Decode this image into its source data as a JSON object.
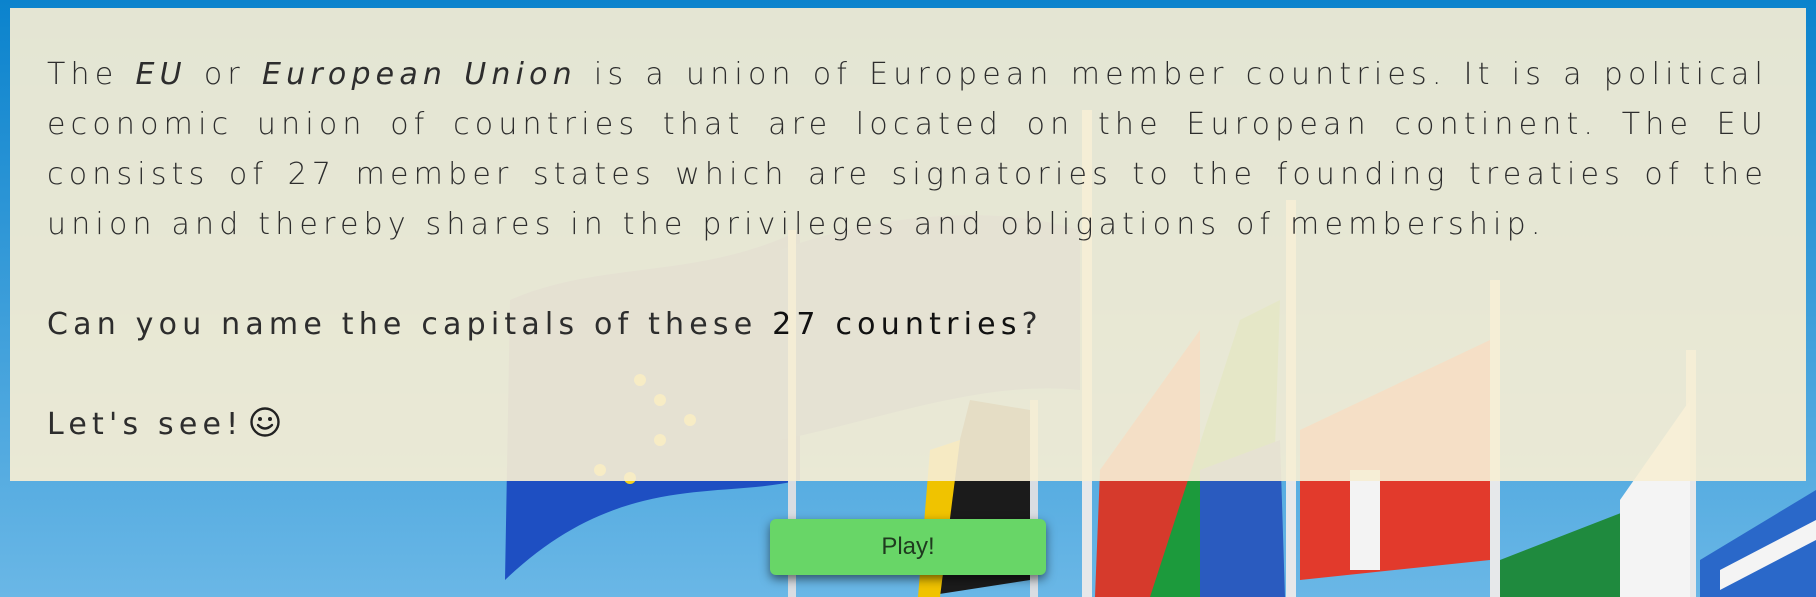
{
  "intro": {
    "p1_a": "The ",
    "p1_eu": "EU",
    "p1_b": " or ",
    "p1_european_union": "European Union",
    "p1_c": " is a union of European member countries. It is a political economic union of countries that are located on the European continent. The EU consists of 27 member states which are signatories to the founding treaties of the union and thereby shares in the privileges and obligations of membership.",
    "question_a": "Can you name the capitals of these ",
    "question_bold": "27 countries",
    "question_b": "?",
    "lets_see": "Let's see!",
    "emoji_icon": "smiling-face-icon"
  },
  "play_button": {
    "label": "Play!"
  },
  "colors": {
    "panel_bg": "#F6EED4",
    "play_button": "#68D667",
    "sky": "#0A84CF"
  }
}
